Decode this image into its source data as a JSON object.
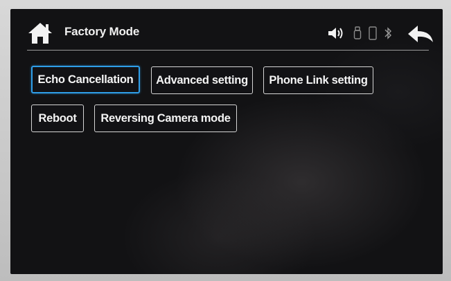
{
  "header": {
    "title": "Factory Mode",
    "home_icon": "home-icon",
    "back_icon": "back-arrow-icon",
    "status_icons": [
      "volume-icon",
      "usb-icon",
      "phone-icon",
      "bluetooth-icon"
    ]
  },
  "menu": {
    "buttons": [
      {
        "label": "Echo Cancellation",
        "selected": true
      },
      {
        "label": "Advanced setting",
        "selected": false
      },
      {
        "label": "Phone Link setting",
        "selected": false
      },
      {
        "label": "Reboot",
        "selected": false
      },
      {
        "label": "Reversing Camera mode",
        "selected": false
      }
    ]
  },
  "colors": {
    "selected_border": "#2f9ee8",
    "button_border": "#d6d6d6",
    "text": "#f4f4f4",
    "background": "#121214"
  }
}
